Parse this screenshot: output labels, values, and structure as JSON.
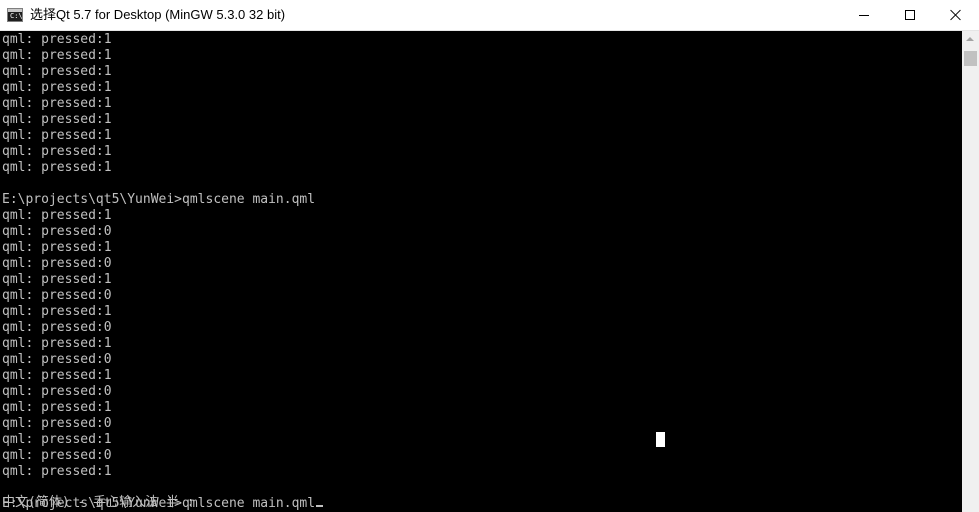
{
  "window": {
    "title": "选择Qt 5.7 for Desktop (MinGW 5.3.0 32 bit)",
    "icon_label": "C:\\."
  },
  "controls": {
    "minimize": "minimize-icon",
    "maximize": "maximize-icon",
    "close": "close-icon"
  },
  "console": {
    "lines": [
      "qml: pressed:1",
      "qml: pressed:1",
      "qml: pressed:1",
      "qml: pressed:1",
      "qml: pressed:1",
      "qml: pressed:1",
      "qml: pressed:1",
      "qml: pressed:1",
      "qml: pressed:1",
      "",
      "E:\\projects\\qt5\\YunWei>qmlscene main.qml",
      "qml: pressed:1",
      "qml: pressed:0",
      "qml: pressed:1",
      "qml: pressed:0",
      "qml: pressed:1",
      "qml: pressed:0",
      "qml: pressed:1",
      "qml: pressed:0",
      "qml: pressed:1",
      "qml: pressed:0",
      "qml: pressed:1",
      "qml: pressed:0",
      "qml: pressed:1",
      "qml: pressed:0",
      "qml: pressed:1",
      "qml: pressed:0",
      "qml: pressed:1",
      "",
      "E:\\projects\\qt5\\YunWei>qmlscene main.qml"
    ],
    "ime_status": "中文(简体) - 手心输入法 半 :"
  },
  "colors": {
    "console_bg": "#000000",
    "console_text": "#c0c0c0",
    "titlebar_bg": "#ffffff"
  }
}
